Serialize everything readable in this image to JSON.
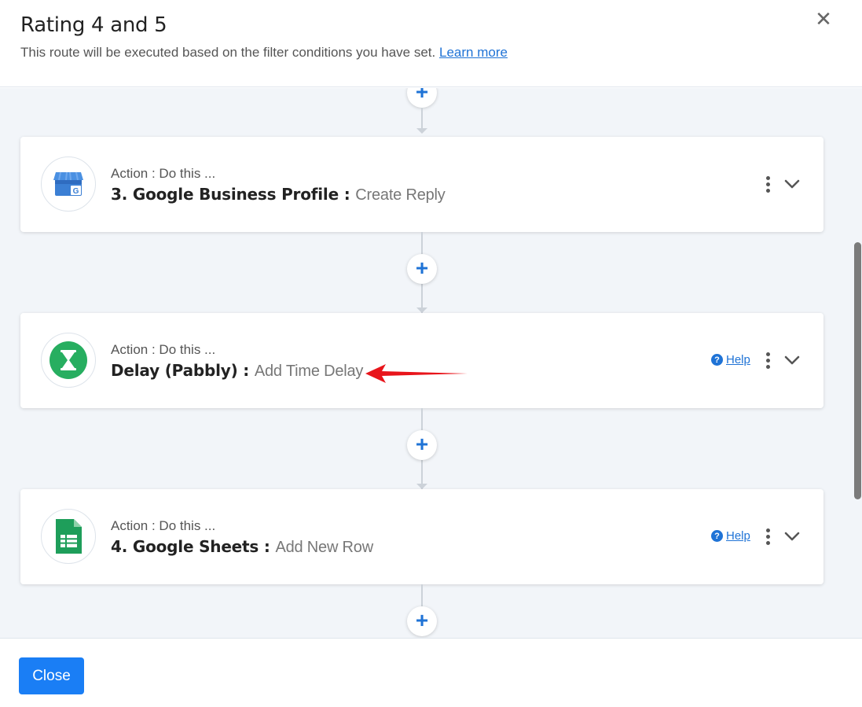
{
  "header": {
    "title": "Rating 4 and 5",
    "subtitle": "This route will be executed based on the filter conditions you have set.",
    "learn_more": "Learn more",
    "close_symbol": "✕"
  },
  "steps": [
    {
      "action_label": "Action : Do this ...",
      "app": "3. Google Business Profile :",
      "event": "Create Reply",
      "icon": "google-business-profile-icon",
      "has_help": false
    },
    {
      "action_label": "Action : Do this ...",
      "app": "Delay (Pabbly) :",
      "event": "Add Time Delay",
      "icon": "hourglass-icon",
      "has_help": true,
      "help_label": "Help"
    },
    {
      "action_label": "Action : Do this ...",
      "app": "4. Google Sheets :",
      "event": "Add New Row",
      "icon": "google-sheets-icon",
      "has_help": true,
      "help_label": "Help"
    }
  ],
  "add_step_symbol": "+",
  "help_symbol": "?",
  "footer": {
    "close_label": "Close"
  },
  "colors": {
    "accent": "#1f73d6",
    "button": "#1a7ef5",
    "annotation_arrow": "#e8151b"
  }
}
